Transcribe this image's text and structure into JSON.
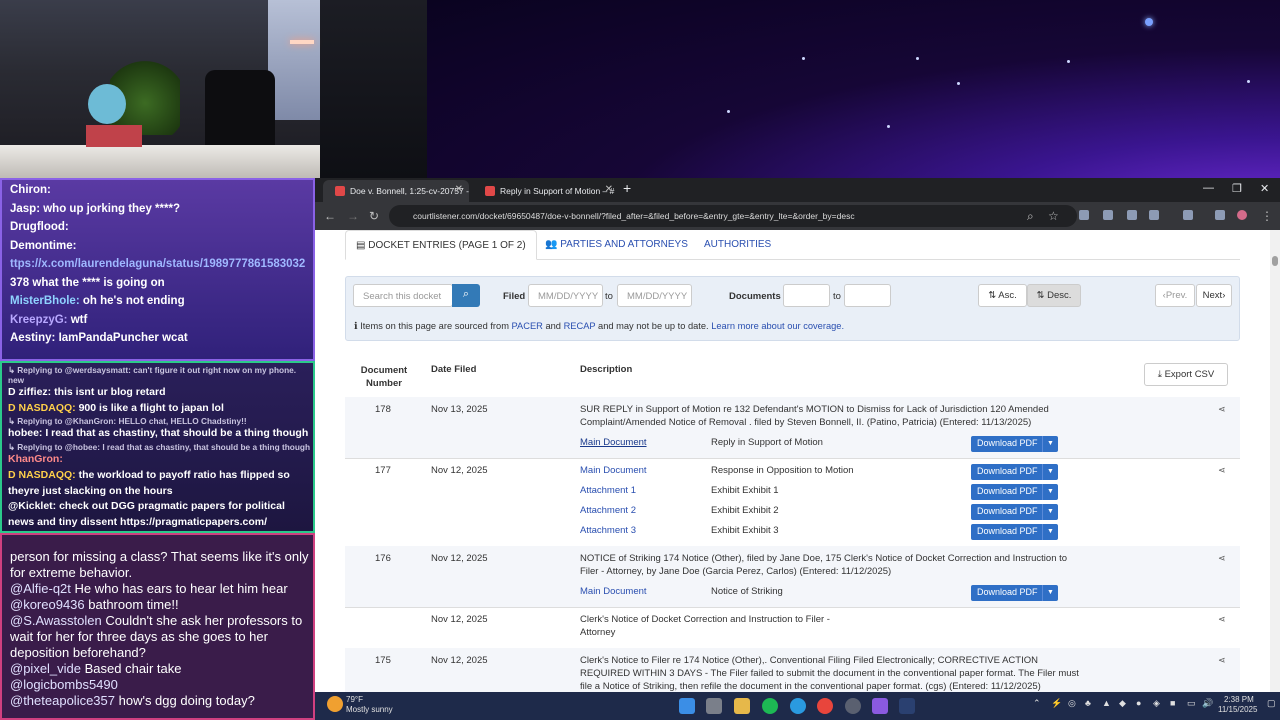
{
  "chat_top": [
    {
      "user": "Chiron:",
      "text": "",
      "color": "#ffffff"
    },
    {
      "user": "Jasp:",
      "text": " who up jorking they ****?",
      "color": "#ffffff"
    },
    {
      "user": "Drugflood:",
      "text": "",
      "color": "#ffffff"
    },
    {
      "user": "Demontime:",
      "text": "",
      "color": "#ffffff"
    },
    {
      "user": "",
      "text": "ttps://x.com/laurendelaguna/status/1989777861583032",
      "color": "#9fb8ff"
    },
    {
      "user": "378",
      "text": " what the **** is going on",
      "color": "#ffffff"
    },
    {
      "user": "MisterBhole:",
      "text": " oh he's not ending",
      "color": "#8fd3ff"
    },
    {
      "user": "KreepzyG:",
      "text": " wtf",
      "color": "#b8a8ff"
    },
    {
      "user": "Aestiny:",
      "text": " IamPandaPuncher wcat",
      "color": "#ffffff"
    }
  ],
  "chat_mid": [
    {
      "reply": "↳ Replying to @werdsaysmatt: can't figure it out right now on my phone. new"
    },
    {
      "user": "D ziffiez:",
      "text": " this isnt ur blog retard",
      "color": "#ffffff"
    },
    {
      "user": "D NASDAQQ:",
      "text": " 900 is like a flight to japan lol",
      "color": "#ffd04a"
    },
    {
      "reply": "↳ Replying to @KhanGron: HELLO chat, HELLO Chadstiny!!"
    },
    {
      "user": "hobee:",
      "text": " I read that as chastiny, that should be a thing though",
      "color": "#ffffff"
    },
    {
      "reply": "↳ Replying to @hobee: I read that as chastiny, that should be a thing though"
    },
    {
      "user": "KhanGron:",
      "text": "",
      "color": "#ff8a8a"
    },
    {
      "user": "D NASDAQQ:",
      "text": " the workload to payoff ratio has flipped so theyre just slacking on the hours",
      "color": "#ffd04a"
    },
    {
      "user": "@Kicklet:",
      "text": " check out DGG pragmatic papers for political news and tiny dissent https://pragmaticpapers.com/",
      "color": "#ffffff"
    }
  ],
  "chat_bottom": [
    {
      "user": "",
      "text": "person for missing a class? That seems like it's only for extreme behavior."
    },
    {
      "user": "@Alfie-q2t",
      "text": " He who has ears to hear let him hear"
    },
    {
      "user": "@koreo9436",
      "text": " bathroom time!!"
    },
    {
      "user": "@S.Awasstolen",
      "text": " Couldn't she ask her professors to wait for her for three days as she goes to her deposition beforehand?"
    },
    {
      "user": "@pixel_vide",
      "text": " Based chair take"
    },
    {
      "user": "@logicbombs5490",
      "text": ""
    },
    {
      "user": "@theteapolice357",
      "text": " how's dgg doing today?"
    }
  ],
  "browser": {
    "tabs": [
      "Doe v. Bonnell, 1:25-cv-20757 -",
      "Reply in Support of Motion – #"
    ],
    "url": "courtlistener.com/docket/69650487/doe-v-bonnell/?filed_after=&filed_before=&entry_gte=&entry_lte=&order_by=desc"
  },
  "page": {
    "tab_entries": "DOCKET ENTRIES (PAGE 1 OF 2)",
    "tab_parties": "PARTIES AND ATTORNEYS",
    "tab_authorities": "AUTHORITIES",
    "search_placeholder": "Search this docket",
    "filed_label": "Filed",
    "date_placeholder": "MM/DD/YYYY",
    "to_label": "to",
    "documents_label": "Documents",
    "asc": "Asc.",
    "desc": "Desc.",
    "prev": "Prev.",
    "next": "Next",
    "info_pre": "Items on this page are sourced from ",
    "info_pacer": "PACER",
    "info_and": " and ",
    "info_recap": "RECAP",
    "info_mid": " and may not be up to date. ",
    "info_link": "Learn more about our coverage.",
    "col_number": "Document Number",
    "col_date": "Date Filed",
    "col_desc": "Description",
    "export": "Export CSV",
    "download": "Download PDF"
  },
  "entries": [
    {
      "num": "178",
      "date": "Nov 13, 2025",
      "desc": "SUR REPLY in Support of Motion re 132 Defendant's MOTION to Dismiss for Lack of Jurisdiction 120 Amended Complaint/Amended Notice of Removal . filed by Steven Bonnell, II. (Patino, Patricia) (Entered: 11/13/2025)",
      "docs": [
        {
          "name": "Main Document",
          "desc": "Reply in Support of Motion"
        }
      ]
    },
    {
      "num": "177",
      "date": "Nov 12, 2025",
      "desc": "",
      "docs": [
        {
          "name": "Main Document",
          "desc": "Response in Opposition to Motion"
        },
        {
          "name": "Attachment 1",
          "desc": "Exhibit Exhibit 1"
        },
        {
          "name": "Attachment 2",
          "desc": "Exhibit Exhibit 2"
        },
        {
          "name": "Attachment 3",
          "desc": "Exhibit Exhibit 3"
        }
      ]
    },
    {
      "num": "176",
      "date": "Nov 12, 2025",
      "desc": "NOTICE of Striking 174 Notice (Other), filed by Jane Doe, 175 Clerk's Notice of Docket Correction and Instruction to Filer - Attorney, by Jane Doe (Garcia Perez, Carlos) (Entered: 11/12/2025)",
      "docs": [
        {
          "name": "Main Document",
          "desc": "Notice of Striking"
        }
      ]
    },
    {
      "num": "",
      "date": "Nov 12, 2025",
      "desc": "Clerk's Notice of Docket Correction and Instruction to Filer - Attorney",
      "docs": []
    },
    {
      "num": "175",
      "date": "Nov 12, 2025",
      "desc": "Clerk's Notice to Filer re 174 Notice (Other),. Conventional Filing Filed Electronically; CORRECTIVE ACTION REQUIRED WITHIN 3 DAYS - The Filer failed to submit the document in the conventional paper format. The Filer must file a Notice of Striking, then refile the document in the conventional paper format. (cgs) (Entered: 11/12/2025)",
      "docs": []
    }
  ],
  "taskbar": {
    "temp": "79°F",
    "weather": "Mostly sunny",
    "time": "2:38 PM",
    "date": "11/15/2025"
  }
}
